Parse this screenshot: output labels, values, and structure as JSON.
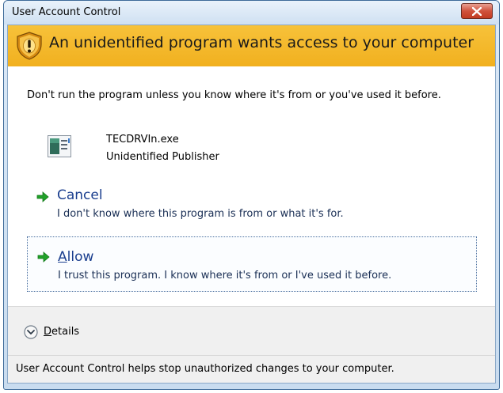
{
  "window": {
    "title": "User Account Control",
    "close_label": "close"
  },
  "banner": {
    "text": "An unidentified program wants access to your computer"
  },
  "warning": {
    "text": "Don't run the program unless you know where it's from or you've used it before."
  },
  "program": {
    "name": "TECDRVIn.exe",
    "publisher": "Unidentified Publisher"
  },
  "options": {
    "cancel": {
      "title": "Cancel",
      "description": "I don't know where this program is from or what it's for."
    },
    "allow": {
      "title_accel": "A",
      "title_rest": "llow",
      "description": "I trust this program. I know where it's from or I've used it before."
    }
  },
  "details": {
    "label_accel": "D",
    "label_rest": "etails"
  },
  "footer": {
    "text": "User Account Control helps stop unauthorized changes to your computer."
  },
  "colors": {
    "banner": "#f1b01f",
    "option_title": "#1b3f8f",
    "arrow": "#21a12a",
    "close_button": "#c23b22"
  },
  "icons": {
    "shield": "shield-warning-icon",
    "program": "program-icon",
    "arrow": "green-arrow-icon",
    "chevron": "chevron-down-icon",
    "close": "close-icon"
  }
}
